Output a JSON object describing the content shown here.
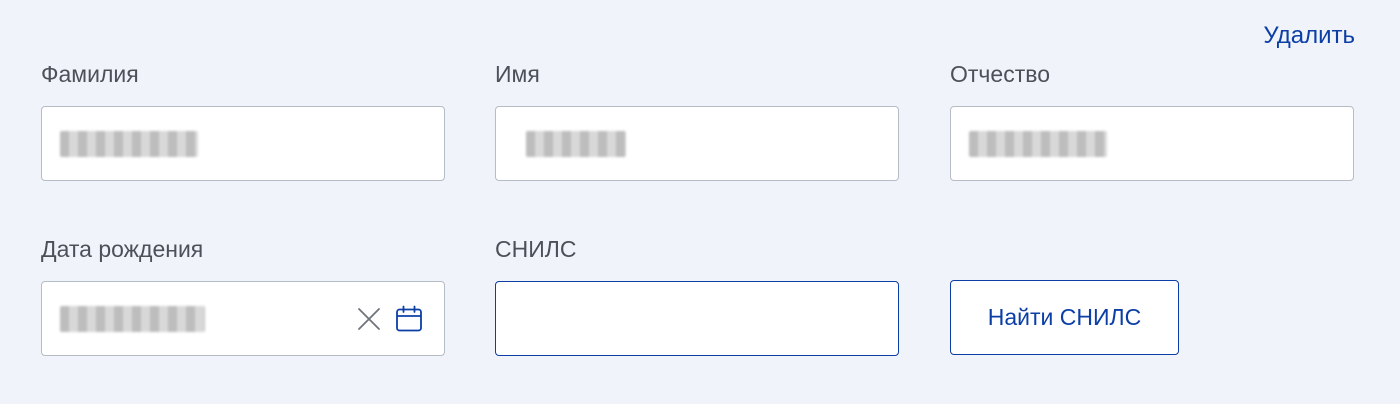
{
  "actions": {
    "delete_label": "Удалить",
    "find_snils_label": "Найти СНИЛС"
  },
  "fields": {
    "surname": {
      "label": "Фамилия"
    },
    "name": {
      "label": "Имя"
    },
    "patronymic": {
      "label": "Отчество"
    },
    "birth_date": {
      "label": "Дата рождения"
    },
    "snils": {
      "label": "СНИЛС",
      "value": ""
    }
  },
  "icons": {
    "clear": "close-icon",
    "calendar": "calendar-icon"
  },
  "colors": {
    "accent": "#0b3fa6",
    "background": "#f0f3fa",
    "label": "#4c5058",
    "border": "#b6bcc6"
  }
}
